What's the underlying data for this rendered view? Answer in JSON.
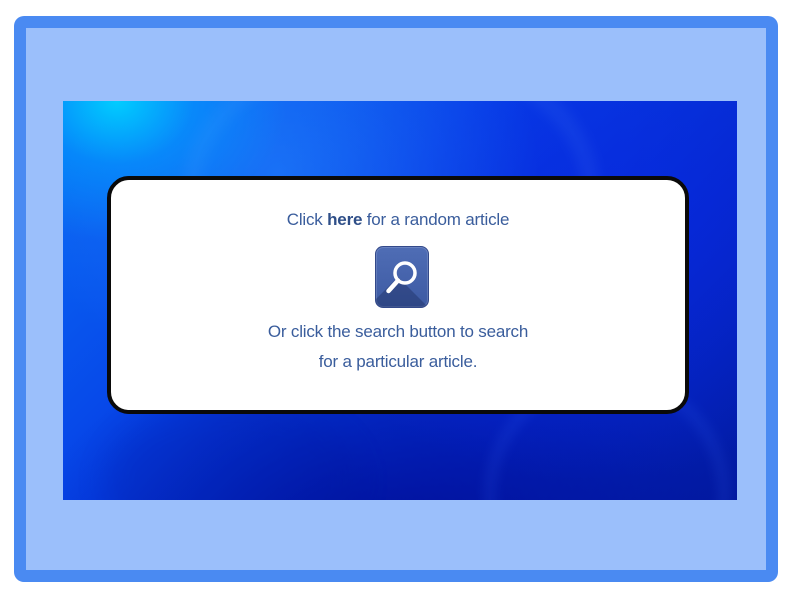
{
  "colors": {
    "frame_border": "#4a8af2",
    "frame_fill": "#9bbffb",
    "text": "#3a5d9c",
    "link": "#2f4f88",
    "search_button": "#4463ab"
  },
  "random_article": {
    "prefix": "Click ",
    "link_text": "here",
    "suffix": " for a random article"
  },
  "search": {
    "icon": "magnifier-icon",
    "line1": "Or click the search button to search",
    "line2": "for a particular article."
  }
}
